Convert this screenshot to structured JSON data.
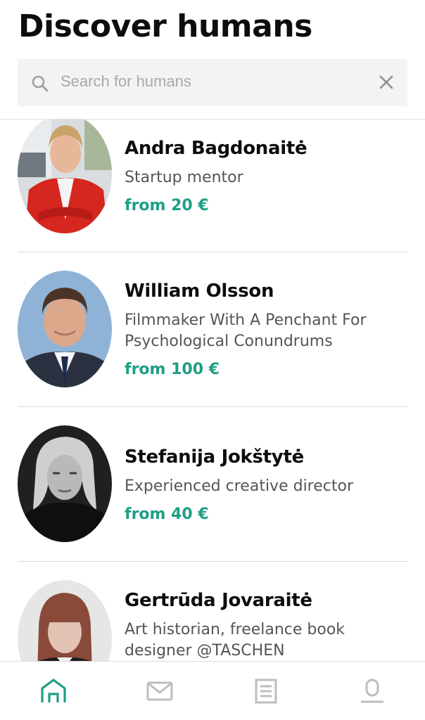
{
  "header": {
    "title": "Discover humans"
  },
  "search": {
    "placeholder": "Search for humans",
    "value": ""
  },
  "people": [
    {
      "name": "Andra Bagdonaitė",
      "title": "Startup mentor",
      "price": "from 20 €"
    },
    {
      "name": "William Olsson",
      "title": "Filmmaker With A Penchant For Psychological Conundrums",
      "price": "from 100 €"
    },
    {
      "name": "Stefanija Jokštytė",
      "title": "Experienced creative director",
      "price": "from 40 €"
    },
    {
      "name": "Gertrūda Jovaraitė",
      "title": "Art historian, freelance book designer @TASCHEN",
      "price": ""
    }
  ],
  "tabs": [
    {
      "icon": "home-icon",
      "active": true
    },
    {
      "icon": "messages-icon",
      "active": false
    },
    {
      "icon": "list-icon",
      "active": false
    },
    {
      "icon": "profile-icon",
      "active": false
    }
  ],
  "colors": {
    "accent": "#1f9e86",
    "inactive_icon": "#bdbdbd",
    "search_bg": "#f3f3f3"
  }
}
